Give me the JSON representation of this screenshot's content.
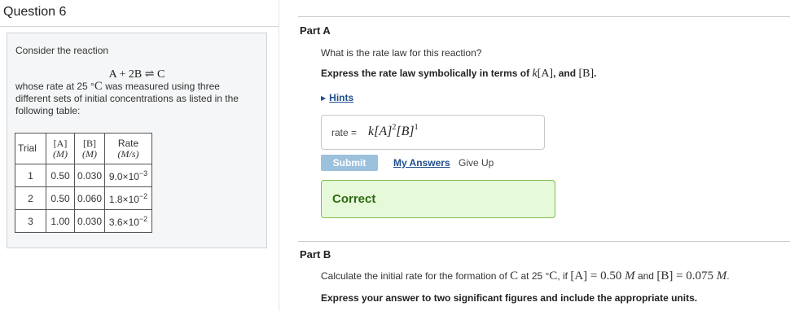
{
  "question": {
    "title": "Question 6",
    "intro": "Consider the reaction",
    "reaction": "A + 2B ⇌ C",
    "description_pre": "whose rate at 25 °",
    "description_c": "C",
    "description_post": " was measured using three different sets of initial concentrations as listed in the following table:",
    "table": {
      "headers": {
        "trial": "Trial",
        "a_top": "[A]",
        "a_unit": "(M)",
        "b_top": "[B]",
        "b_unit": "(M)",
        "rate_top": "Rate",
        "rate_unit": "(M/s)"
      },
      "rows": [
        {
          "trial": "1",
          "a": "0.50",
          "b": "0.030",
          "rate_base": "9.0×10",
          "rate_exp": "−3"
        },
        {
          "trial": "2",
          "a": "0.50",
          "b": "0.060",
          "rate_base": "1.8×10",
          "rate_exp": "−2"
        },
        {
          "trial": "3",
          "a": "1.00",
          "b": "0.030",
          "rate_base": "3.6×10",
          "rate_exp": "−2"
        }
      ]
    }
  },
  "part_a": {
    "title": "Part A",
    "prompt": "What is the rate law for this reaction?",
    "instruction_pre": "Express the rate law symbolically in terms of ",
    "instruction_k": "k",
    "instruction_a": "[A]",
    "instruction_and": ", and ",
    "instruction_b": "[B]",
    "instruction_end": ".",
    "hints_label": "Hints",
    "answer_label": "rate =",
    "answer_k": "k",
    "answer_a": "[A]",
    "answer_a_exp": "2",
    "answer_b": "[B]",
    "answer_b_exp": "1",
    "submit_label": "Submit",
    "my_answers_label": "My Answers",
    "give_up_label": "Give Up",
    "feedback": "Correct"
  },
  "part_b": {
    "title": "Part B",
    "prompt_1": "Calculate the initial rate for the formation of ",
    "prompt_c": "C",
    "prompt_2": " at 25 °",
    "prompt_c2": "C",
    "prompt_3": ", if ",
    "prompt_a": "[A] = 0.50 ",
    "prompt_m1": "M",
    "prompt_and": " and ",
    "prompt_b": "[B] = 0.075 ",
    "prompt_m2": "M",
    "prompt_end": ".",
    "instruction": "Express your answer to two significant figures and include the appropriate units."
  }
}
